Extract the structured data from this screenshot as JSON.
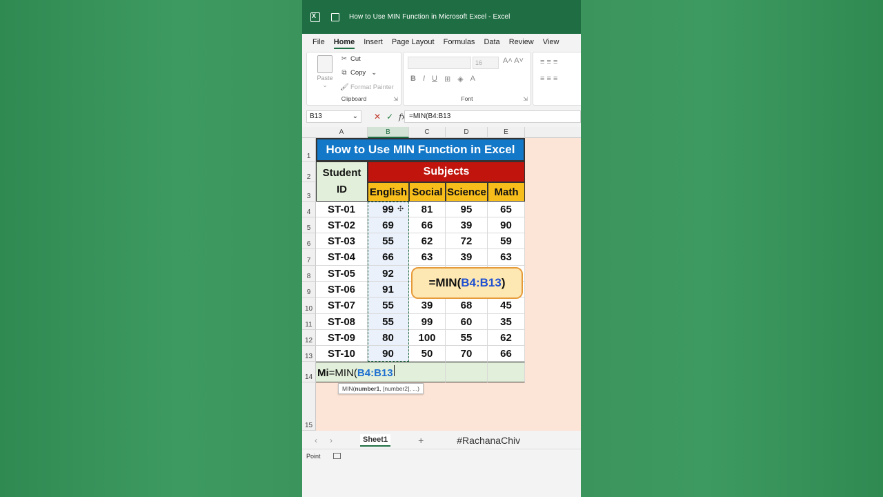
{
  "window": {
    "title": "How to Use MIN Function in Microsoft Excel  -  Excel"
  },
  "tabs": [
    "File",
    "Home",
    "Insert",
    "Page Layout",
    "Formulas",
    "Data",
    "Review",
    "View"
  ],
  "ribbon": {
    "clipboard": {
      "paste": "Paste",
      "cut": "Cut",
      "copy": "Copy",
      "format_painter": "Format Painter",
      "label": "Clipboard"
    },
    "font": {
      "size": "16",
      "label": "Font"
    }
  },
  "formula_bar": {
    "name_box": "B13",
    "formula": "=MIN(B4:B13"
  },
  "columns": [
    "A",
    "B",
    "C",
    "D",
    "E"
  ],
  "rows": [
    "1",
    "2",
    "3",
    "4",
    "5",
    "6",
    "7",
    "8",
    "9",
    "10",
    "11",
    "12",
    "13",
    "14",
    "15"
  ],
  "sheet": {
    "title": "How to Use MIN Function in Excel",
    "student_id_1": "Student",
    "student_id_2": "ID",
    "subjects": "Subjects",
    "subject_headers": [
      "English",
      "Social",
      "Science",
      "Math"
    ],
    "records": [
      [
        "ST-01",
        "99",
        "81",
        "95",
        "65"
      ],
      [
        "ST-02",
        "69",
        "66",
        "39",
        "90"
      ],
      [
        "ST-03",
        "55",
        "62",
        "72",
        "59"
      ],
      [
        "ST-04",
        "66",
        "63",
        "39",
        "63"
      ],
      [
        "ST-05",
        "92",
        "",
        "",
        ""
      ],
      [
        "ST-06",
        "91",
        "",
        "",
        ""
      ],
      [
        "ST-07",
        "55",
        "39",
        "68",
        "45"
      ],
      [
        "ST-08",
        "55",
        "99",
        "60",
        "35"
      ],
      [
        "ST-09",
        "80",
        "100",
        "55",
        "62"
      ],
      [
        "ST-10",
        "90",
        "50",
        "70",
        "66"
      ]
    ],
    "edit_prefix": "Mi",
    "edit_formula_start": "=MIN(",
    "edit_formula_ref": "B4:B13",
    "tooltip_fn": "MIN(",
    "tooltip_arg": "number1",
    "tooltip_rest": ", [number2], ...)",
    "callout_start": "=MIN(",
    "callout_ref": "B4:B13",
    "callout_end": ")"
  },
  "sheet_tabs": {
    "active": "Sheet1",
    "add": "+",
    "hashtag": "#RachanaChiv"
  },
  "status": {
    "mode": "Point"
  },
  "colors": {
    "excel_green": "#1f6e43",
    "title_blue": "#1478c8",
    "subjects_red": "#c0140c",
    "header_yellow": "#f7bd1b",
    "ref_blue": "#1d4fd1"
  }
}
